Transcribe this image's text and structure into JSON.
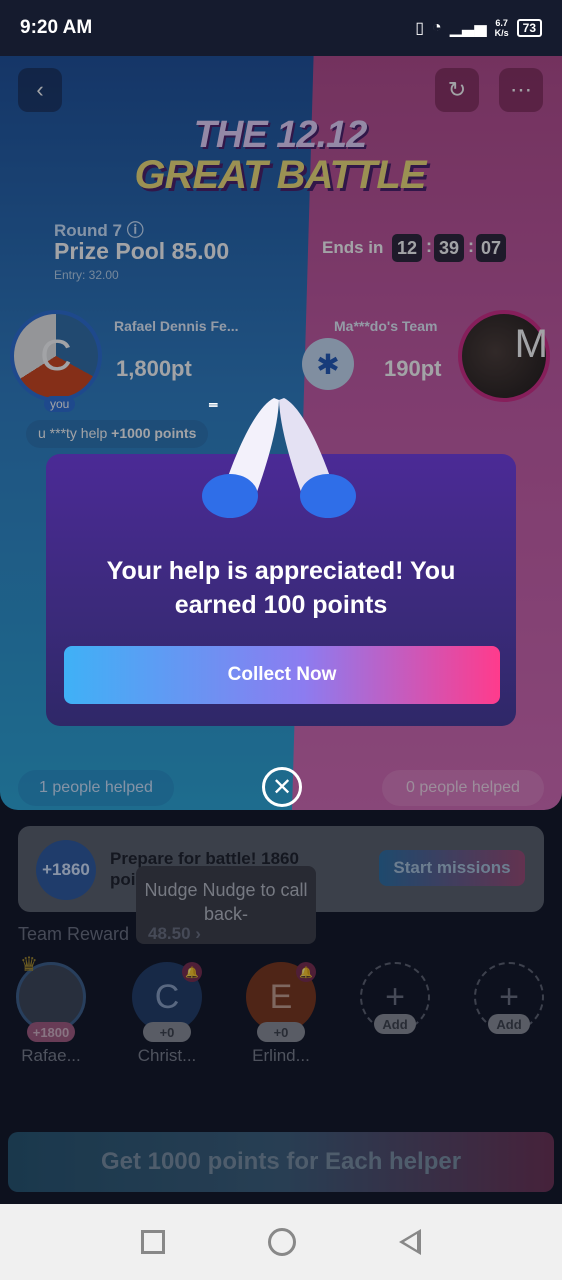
{
  "status_bar": {
    "time": "9:20 AM",
    "net_speed_value": "6.7",
    "net_speed_unit": "K/s",
    "battery": "73"
  },
  "header": {
    "title_line1": "THE 12.12",
    "title_line2": "GREAT BATTLE"
  },
  "round": {
    "label": "Round 7",
    "prize_pool": "Prize Pool 85.00",
    "entry": "Entry: 32.00",
    "ends_in_label": "Ends in",
    "timer": [
      "12",
      "39",
      "07"
    ]
  },
  "teams": {
    "left": {
      "name": "Rafael Dennis Fe...",
      "score": "1,800pt",
      "you_badge": "you",
      "avatar_letters": "C"
    },
    "right": {
      "name": "Ma***do's Team",
      "score": "190pt",
      "avatar_letter": "M"
    }
  },
  "help_chip": {
    "prefix": "u ***ty help",
    "points": "+1000 points"
  },
  "modal": {
    "message": "Your help is appreciated! You earned 100 points",
    "button": "Collect Now"
  },
  "helped": {
    "left": "1 people helped",
    "right": "0 people helped"
  },
  "mission": {
    "badge": "+1860",
    "text": "Prepare for battle! 1860 points up for grab!",
    "button": "Start missions"
  },
  "tooltip": {
    "text": "Nudge Nudge to call back-"
  },
  "team_reward": {
    "label": "Team Reward",
    "value": "48.50"
  },
  "members": [
    {
      "name": "Rafae...",
      "points": "+1800",
      "letter": ""
    },
    {
      "name": "Christ...",
      "points": "+0",
      "letter": "C"
    },
    {
      "name": "Erlind...",
      "points": "+0",
      "letter": "E"
    },
    {
      "name": "Add",
      "points": "",
      "letter": "+"
    },
    {
      "name": "Add",
      "points": "",
      "letter": "+"
    }
  ],
  "bottom_button": "Get 1000 points for Each helper",
  "colors": {
    "left_team": "#2b6fd6",
    "right_team": "#d22a87",
    "modal_bg": "#4b2a96",
    "collect_gradient_start": "#3fb1f6",
    "collect_gradient_end": "#ff3b8c"
  }
}
